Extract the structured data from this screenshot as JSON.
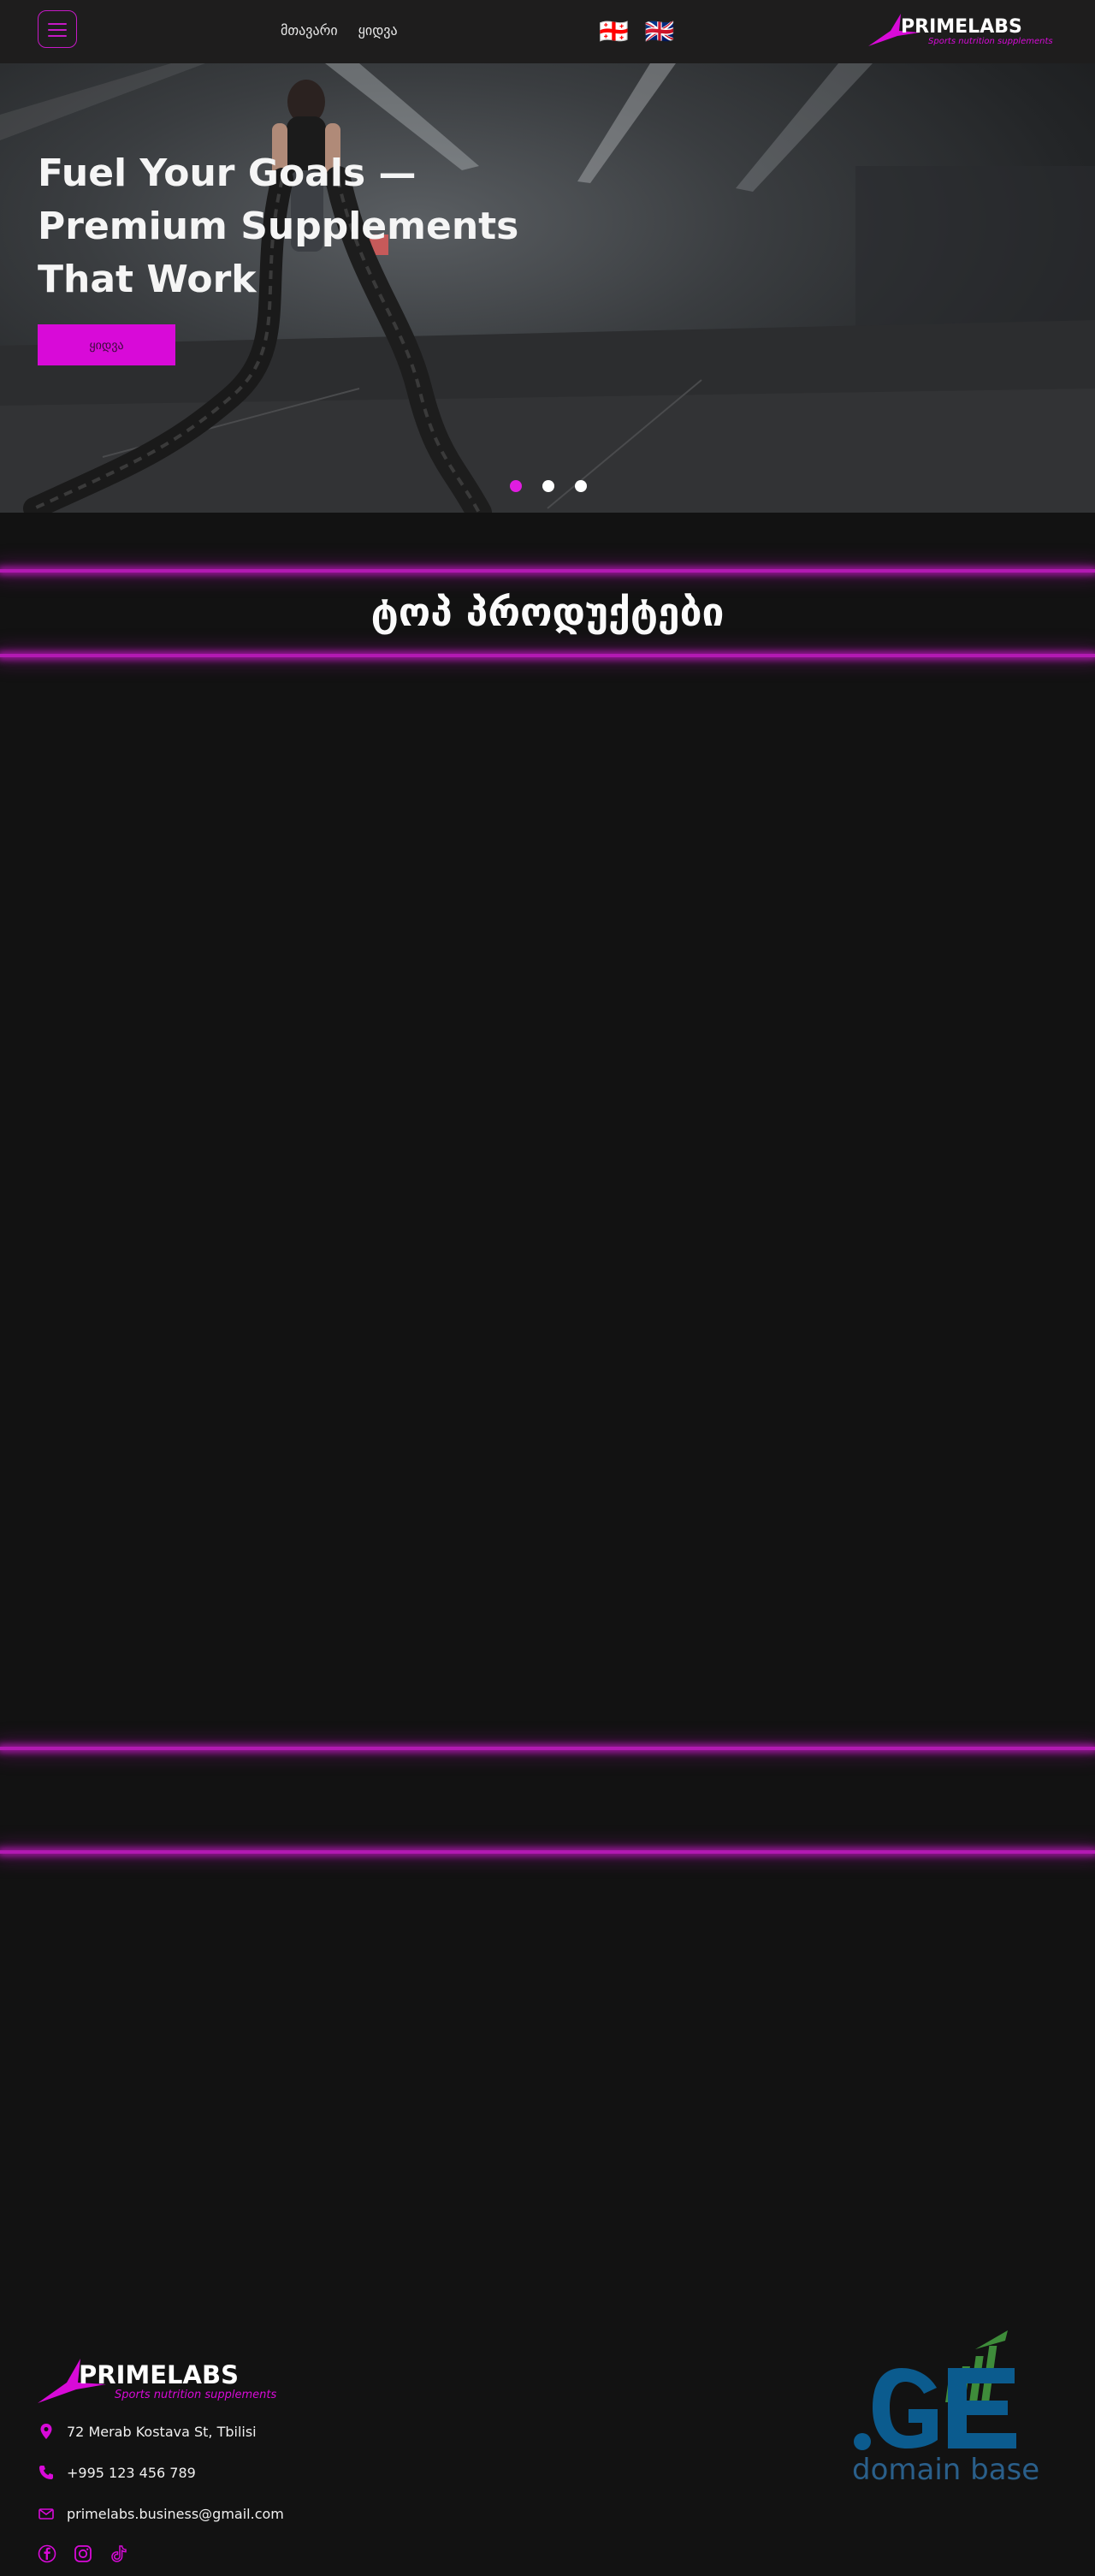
{
  "header": {
    "nav": [
      {
        "label": "მთავარი"
      },
      {
        "label": "ყიდვა"
      }
    ],
    "language_flags": "🇬🇪 🇬🇧",
    "logo_text": "PRIMELABS",
    "logo_tagline": "Sports nutrition supplements"
  },
  "hero": {
    "title": "Fuel Your Goals — Premium Supplements That Work",
    "button_label": "ყიდვა",
    "slides": 3,
    "active_slide": 1
  },
  "top_products": {
    "title": "ტოპ პროდუქტები"
  },
  "footer": {
    "logo_text": "PRIMELABS",
    "logo_tagline": "Sports nutrition supplements",
    "address": "72 Merab Kostava St, Tbilisi",
    "phone": "+995 123 456 789",
    "email": "primelabs.business@gmail.com",
    "socials": [
      "facebook-icon",
      "instagram-icon",
      "tiktok-icon"
    ],
    "partner_logo_mark": ".GE",
    "partner_logo_text": "domain base"
  },
  "colors": {
    "accent": "#d80ad8",
    "background": "#121212",
    "header": "#1e1d1d",
    "partner_blue": "#0b5b8e",
    "partner_green": "#3e8c3a"
  }
}
